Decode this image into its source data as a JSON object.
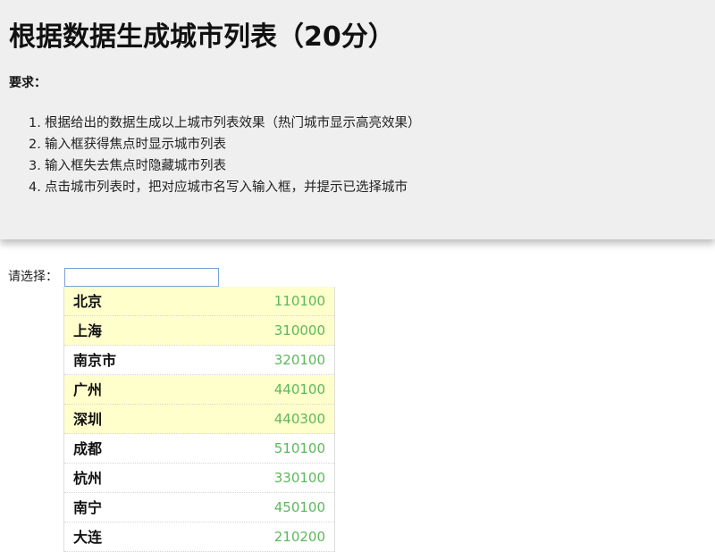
{
  "header": {
    "title": "根据数据生成城市列表（20分）",
    "requirements_heading": "要求：",
    "requirements": [
      {
        "num": "1.",
        "text": "根据给出的数据生成以上城市列表效果（热门城市显示高亮效果）"
      },
      {
        "num": "2.",
        "text": "输入框获得焦点时显示城市列表"
      },
      {
        "num": "3.",
        "text": "输入框失去焦点时隐藏城市列表"
      },
      {
        "num": "4.",
        "text": "点击城市列表时，把对应城市名写入输入框，并提示已选择城市"
      }
    ]
  },
  "form": {
    "label": "请选择：",
    "input_value": "",
    "input_placeholder": ""
  },
  "colors": {
    "header_bg": "#efefef",
    "hot_bg": "#ffffcc",
    "code_color": "#5cb85c",
    "input_border": "#7b9fd9"
  },
  "cities": [
    {
      "name": "北京",
      "code": "110100",
      "hot": true
    },
    {
      "name": "上海",
      "code": "310000",
      "hot": true
    },
    {
      "name": "南京市",
      "code": "320100",
      "hot": false
    },
    {
      "name": "广州",
      "code": "440100",
      "hot": true
    },
    {
      "name": "深圳",
      "code": "440300",
      "hot": true
    },
    {
      "name": "成都",
      "code": "510100",
      "hot": false
    },
    {
      "name": "杭州",
      "code": "330100",
      "hot": false
    },
    {
      "name": "南宁",
      "code": "450100",
      "hot": false
    },
    {
      "name": "大连",
      "code": "210200",
      "hot": false
    }
  ]
}
